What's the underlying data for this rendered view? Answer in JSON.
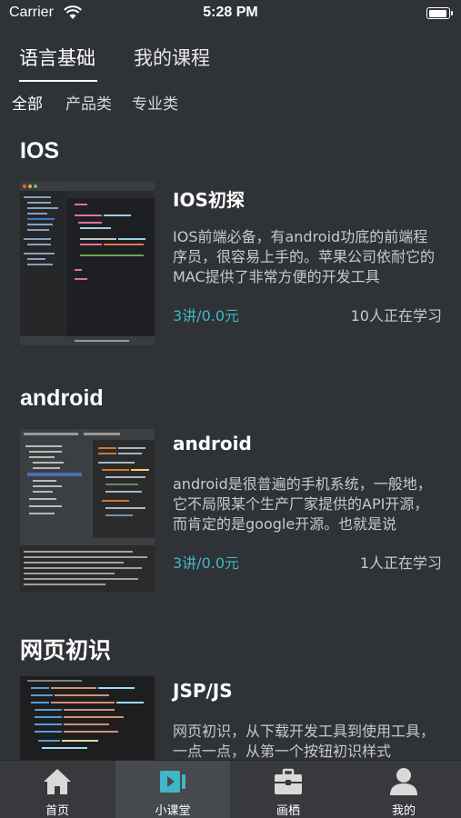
{
  "status_bar": {
    "carrier": "Carrier",
    "time": "5:28 PM"
  },
  "top_tabs": [
    {
      "label": "语言基础",
      "active": true
    },
    {
      "label": "我的课程",
      "active": false
    }
  ],
  "sub_tabs": [
    {
      "label": "全部",
      "active": true
    },
    {
      "label": "产品类",
      "active": false
    },
    {
      "label": "专业类",
      "active": false
    }
  ],
  "sections": [
    {
      "title": "IOS",
      "course": {
        "title": "IOS初探",
        "description": "IOS前端必备，有android功底的前端程序员，很容易上手的。苹果公司依耐它的MAC提供了非常方便的开发工具",
        "price": "3讲/0.0元",
        "learners": "10人正在学习"
      }
    },
    {
      "title": "android",
      "course": {
        "title": "android",
        "description": "android是很普遍的手机系统，一般地，它不局限某个生产厂家提供的API开源，而肯定的是google开源。也就是说",
        "price": "3讲/0.0元",
        "learners": "1人正在学习"
      }
    },
    {
      "title": "网页初识",
      "course": {
        "title": "JSP/JS",
        "description": "网页初识，从下载开发工具到使用工具，一点一点，从第一个按钮初识样式",
        "price": "",
        "learners": ""
      }
    }
  ],
  "tab_bar": [
    {
      "label": "首页",
      "icon": "home-icon",
      "active": false
    },
    {
      "label": "小课堂",
      "icon": "video-icon",
      "active": true
    },
    {
      "label": "画栖",
      "icon": "briefcase-icon",
      "active": false
    },
    {
      "label": "我的",
      "icon": "user-icon",
      "active": false
    }
  ],
  "colors": {
    "background": "#2f3236",
    "accent": "#3fb7c6",
    "tabbar": "#37393d"
  }
}
